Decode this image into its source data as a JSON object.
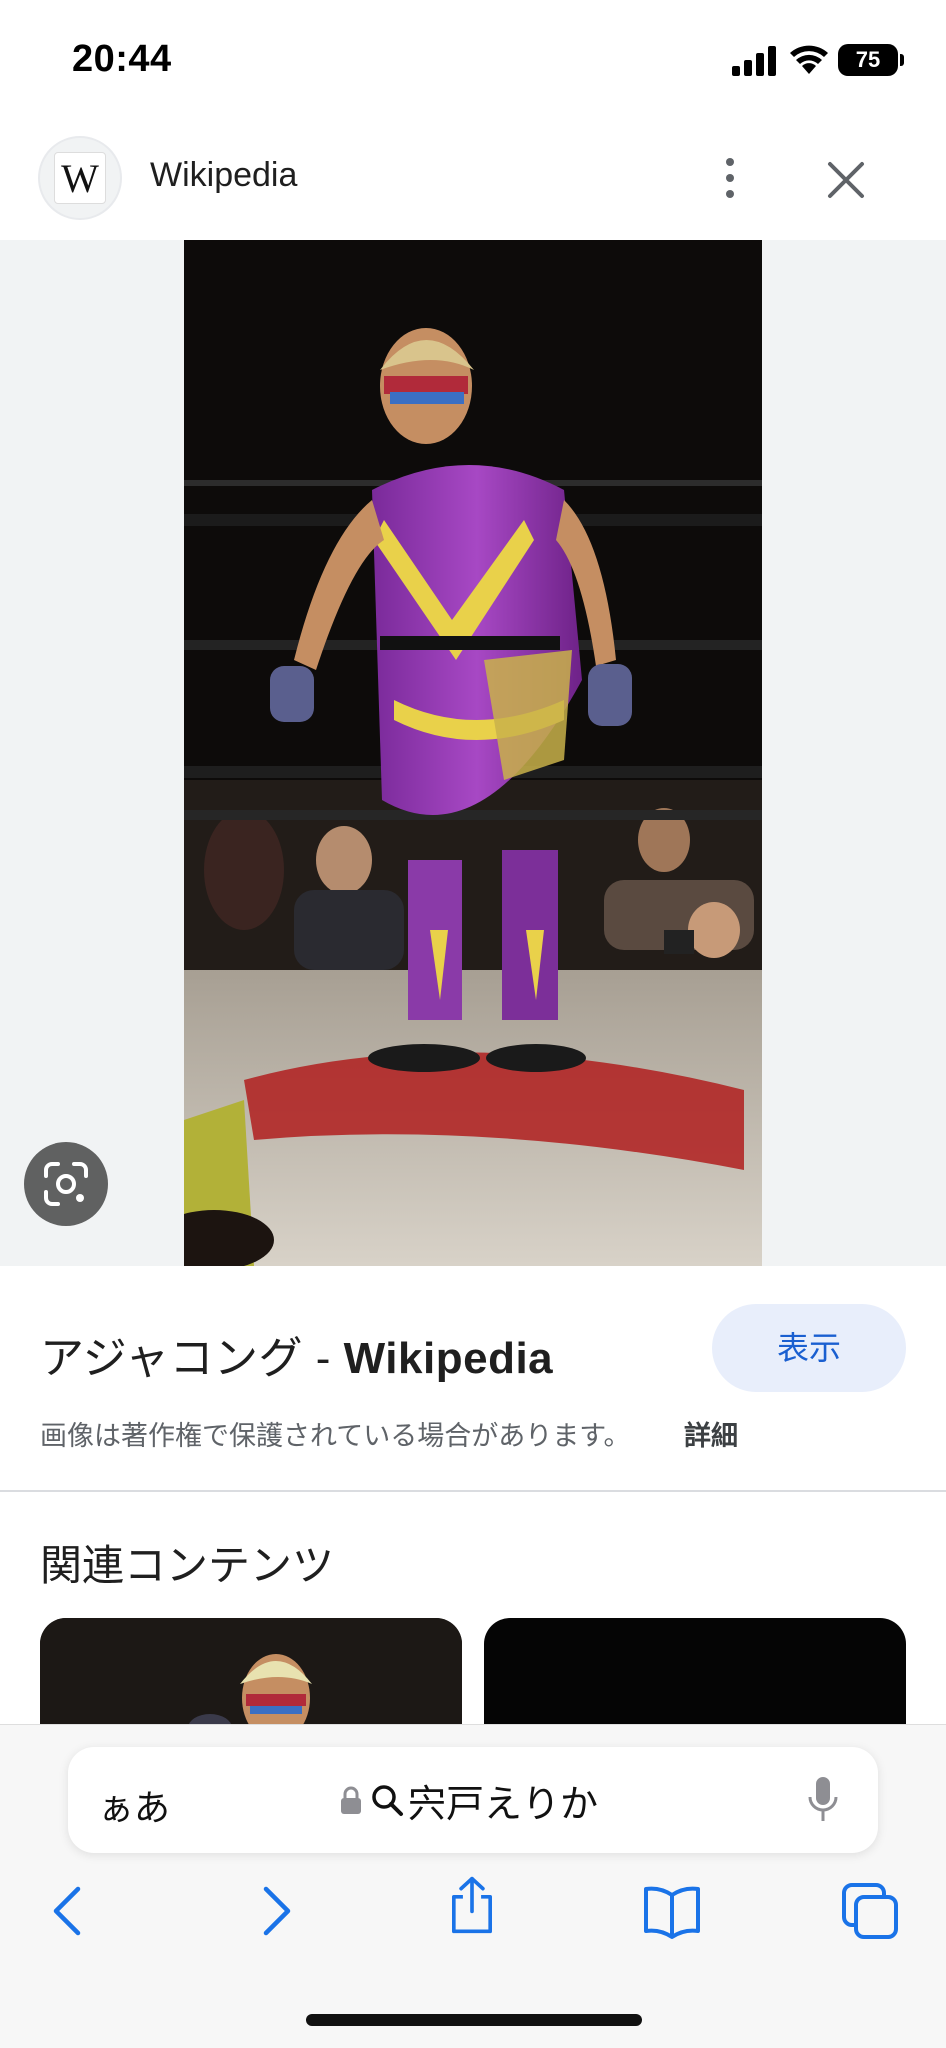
{
  "status_bar": {
    "time": "20:44",
    "battery": "75",
    "icons": [
      "signal-icon",
      "wifi-icon",
      "battery-icon"
    ]
  },
  "header": {
    "logo_letter": "W",
    "site_name": "Wikipedia",
    "icons": [
      "more-vert-icon",
      "close-icon"
    ]
  },
  "image_viewer": {
    "lens_icon": "google-lens-icon"
  },
  "result": {
    "title_prefix": "アジャコング - ",
    "title_site": "Wikipedia",
    "visit_label": "表示",
    "copyright_notice": "画像は著作権で保護されている場合があります。",
    "details_label": "詳細"
  },
  "related": {
    "heading": "関連コンテンツ"
  },
  "browser": {
    "reader_label": "ぁあ",
    "url_text": "宍戸えりか",
    "icons": [
      "lock-icon",
      "search-icon",
      "mic-icon",
      "back-icon",
      "forward-icon",
      "share-icon",
      "bookmarks-icon",
      "tabs-icon"
    ]
  },
  "colors": {
    "accent_blue": "#1a73e8",
    "visit_button_bg": "#e8eefb",
    "image_bg": "#f1f3f4"
  }
}
